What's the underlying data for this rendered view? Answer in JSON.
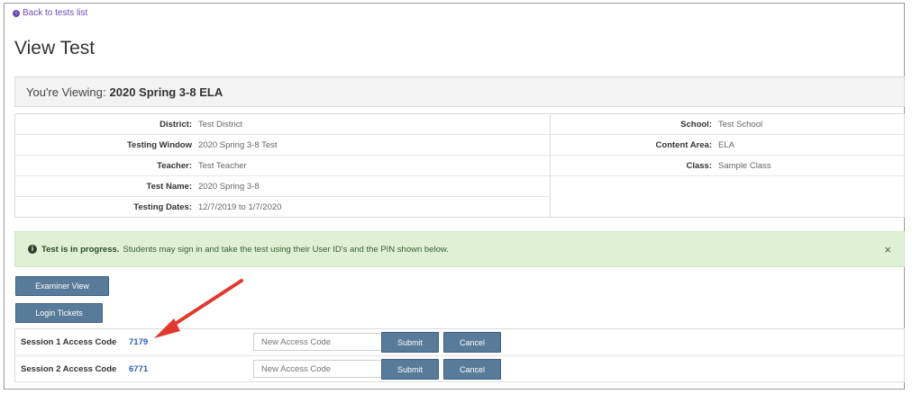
{
  "nav": {
    "back_label": "Back to tests list"
  },
  "page": {
    "title": "View Test"
  },
  "viewing": {
    "prefix": "You're Viewing:",
    "test_name": "2020 Spring 3-8 ELA"
  },
  "details": {
    "left": [
      {
        "label": "District:",
        "value": "Test District"
      },
      {
        "label": "Testing Window",
        "value": "2020 Spring 3-8 Test"
      },
      {
        "label": "Teacher:",
        "value": "Test Teacher"
      },
      {
        "label": "Test Name:",
        "value": "2020 Spring 3-8"
      },
      {
        "label": "Testing Dates:",
        "value": "12/7/2019 to 1/7/2020"
      }
    ],
    "right": [
      {
        "label": "School:",
        "value": "Test School"
      },
      {
        "label": "Content Area:",
        "value": "ELA"
      },
      {
        "label": "Class:",
        "value": "Sample Class"
      }
    ]
  },
  "alert": {
    "icon": "info-icon",
    "bold": "Test is in progress.",
    "text": "Students may sign in and take the test using their User ID's and the PIN shown below.",
    "close": "×"
  },
  "buttons": {
    "examiner_view": "Examiner View",
    "login_tickets": "Login Tickets"
  },
  "sessions": [
    {
      "label": "Session 1 Access Code",
      "code": "7179",
      "placeholder": "New Access Code",
      "submit": "Submit",
      "cancel": "Cancel"
    },
    {
      "label": "Session 2 Access Code",
      "code": "6771",
      "placeholder": "New Access Code",
      "submit": "Submit",
      "cancel": "Cancel"
    }
  ],
  "colors": {
    "button": "#587b9a",
    "alert_bg": "#def1d4",
    "arrow": "#e03a2f",
    "link": "#2f61b6"
  }
}
